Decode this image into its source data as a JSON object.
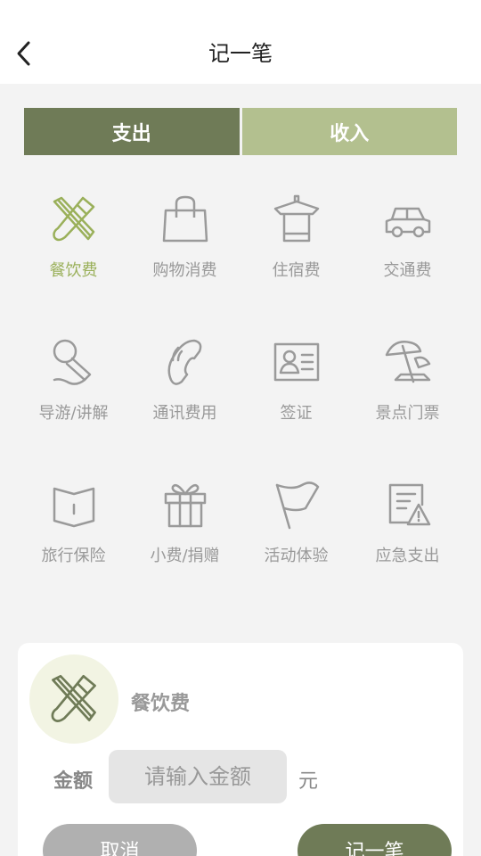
{
  "header": {
    "title": "记一笔",
    "back_icon": "chevron-left-icon"
  },
  "tabs": [
    {
      "label": "支出",
      "active": true
    },
    {
      "label": "收入",
      "active": false
    }
  ],
  "categories": [
    {
      "label": "餐饮费",
      "icon": "utensils-icon",
      "selected": true
    },
    {
      "label": "购物消费",
      "icon": "shopping-bag-icon",
      "selected": false
    },
    {
      "label": "住宿费",
      "icon": "hotel-icon",
      "selected": false
    },
    {
      "label": "交通费",
      "icon": "car-icon",
      "selected": false
    },
    {
      "label": "导游/讲解",
      "icon": "microphone-icon",
      "selected": false
    },
    {
      "label": "通讯费用",
      "icon": "phone-icon",
      "selected": false
    },
    {
      "label": "签证",
      "icon": "id-card-icon",
      "selected": false
    },
    {
      "label": "景点门票",
      "icon": "beach-umbrella-icon",
      "selected": false
    },
    {
      "label": "旅行保险",
      "icon": "book-icon",
      "selected": false
    },
    {
      "label": "小费/捐赠",
      "icon": "gift-icon",
      "selected": false
    },
    {
      "label": "活动体验",
      "icon": "flag-icon",
      "selected": false
    },
    {
      "label": "应急支出",
      "icon": "warning-document-icon",
      "selected": false
    }
  ],
  "panel": {
    "selected_category": "餐饮费",
    "selected_icon": "utensils-icon",
    "amount_label": "金额",
    "amount_value": "",
    "amount_placeholder": "请输入金额",
    "unit": "元",
    "cancel_label": "取消",
    "submit_label": "记一笔"
  },
  "colors": {
    "accent": "#6f7b57",
    "accent_light": "#b3c08f",
    "selected_text": "#9ab05a",
    "icon_gray": "#9a9a9a"
  }
}
